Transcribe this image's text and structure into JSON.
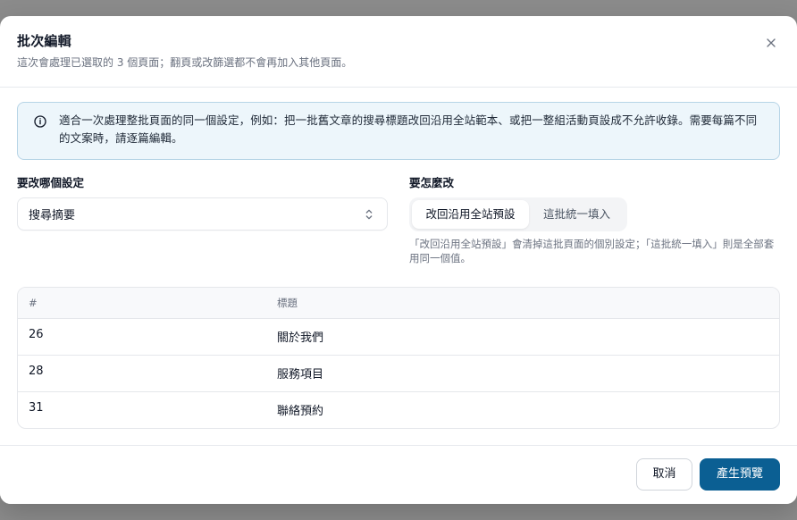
{
  "dialog": {
    "title": "批次編輯",
    "subtitle": "這次會處理已選取的 3 個頁面；翻頁或改篩選都不會再加入其他頁面。",
    "close_icon": "close-icon"
  },
  "info": {
    "icon": "info-icon",
    "text": "適合一次處理整批頁面的同一個設定，例如：把一批舊文章的搜尋標題改回沿用全站範本、或把一整組活動頁設成不允許收錄。需要每篇不同的文案時，請逐篇編輯。"
  },
  "setting": {
    "label": "要改哪個設定",
    "selected_value": "搜尋摘要",
    "icon": "chevrons-up-down-icon"
  },
  "mode": {
    "label": "要怎麼改",
    "options": [
      {
        "label": "改回沿用全站預設",
        "active": true
      },
      {
        "label": "這批統一填入",
        "active": false
      }
    ],
    "helper": "「改回沿用全站預設」會清掉這批頁面的個別設定；「這批統一填入」則是全部套用同一個值。"
  },
  "table": {
    "headers": [
      "#",
      "標題"
    ],
    "rows": [
      {
        "id": "26",
        "title": "關於我們"
      },
      {
        "id": "28",
        "title": "服務項目"
      },
      {
        "id": "31",
        "title": "聯絡預約"
      }
    ]
  },
  "footer": {
    "cancel_label": "取消",
    "primary_label": "產生預覽"
  },
  "colors": {
    "primary": "#0b5f93",
    "info_bg": "#edf6fb",
    "info_border": "#b6d4e6"
  }
}
